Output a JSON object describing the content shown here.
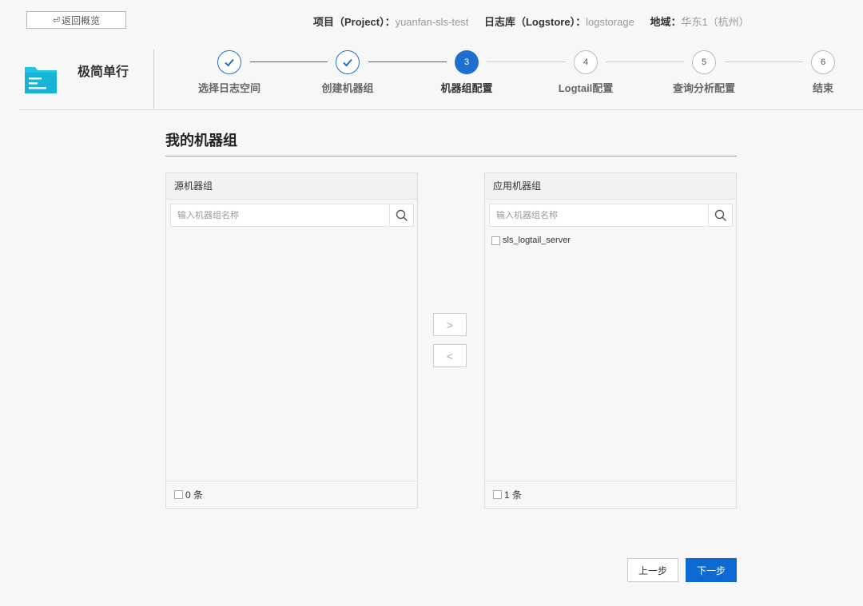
{
  "header": {
    "back_label": "返回概览",
    "project_key": "项目（Project）：",
    "project_value": "yuanfan-sls-test",
    "logstore_key": "日志库（Logstore）：",
    "logstore_value": "logstorage",
    "region_key": "地域：",
    "region_value": "华东1（杭州）"
  },
  "mode": {
    "title": "极简单行"
  },
  "steps": [
    {
      "number": "1",
      "label": "选择日志空间",
      "state": "done"
    },
    {
      "number": "2",
      "label": "创建机器组",
      "state": "done"
    },
    {
      "number": "3",
      "label": "机器组配置",
      "state": "active"
    },
    {
      "number": "4",
      "label": "Logtail配置",
      "state": "todo"
    },
    {
      "number": "5",
      "label": "查询分析配置",
      "state": "todo"
    },
    {
      "number": "6",
      "label": "结束",
      "state": "todo"
    }
  ],
  "section": {
    "title": "我的机器组"
  },
  "source_panel": {
    "title": "源机器组",
    "search_placeholder": "输入机器组名称",
    "items": [],
    "count_label": "0 条"
  },
  "target_panel": {
    "title": "应用机器组",
    "search_placeholder": "输入机器组名称",
    "items": [
      "sls_logtail_server"
    ],
    "count_label": "1 条"
  },
  "transfer": {
    "to_right": ">",
    "to_left": "<"
  },
  "footer": {
    "prev_label": "上一步",
    "next_label": "下一步"
  },
  "colors": {
    "accent": "#1f6fd1",
    "primary_button": "#0d6ad3",
    "folder_icon": "#1ec5e6"
  }
}
